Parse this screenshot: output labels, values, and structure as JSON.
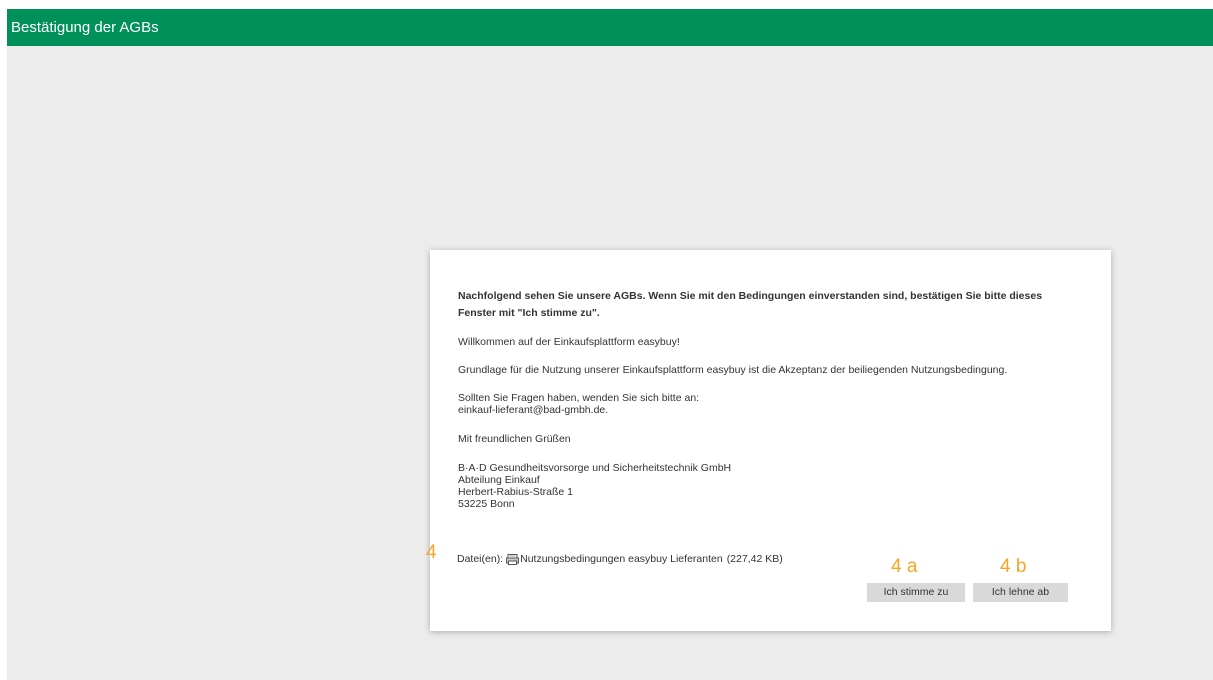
{
  "window": {
    "title": "Bestätigung der AGBs"
  },
  "dialog": {
    "intro": [
      "Nachfolgend sehen Sie unsere AGBs. Wenn Sie mit den Bedingungen einverstanden sind, bestätigen Sie bitte dieses",
      "Fenster mit \"Ich stimme zu\"."
    ],
    "welcome": "Willkommen auf der Einkaufsplattform easybuy!",
    "basis": "Grundlage für die Nutzung unserer Einkaufsplattform easybuy ist die Akzeptanz der beiliegenden Nutzungsbedingung.",
    "questions": [
      "Sollten Sie Fragen haben, wenden Sie sich bitte an:",
      "einkauf-lieferant@bad-gmbh.de."
    ],
    "greeting": "Mit freundlichen Grüßen",
    "company": [
      "B·A·D Gesundheitsvorsorge und Sicherheitstechnik GmbH",
      "Abteilung Einkauf",
      "Herbert-Rabius-Straße 1",
      "53225 Bonn"
    ],
    "files": {
      "label": "Datei(en):",
      "icon": "pdf-file-icon",
      "name": "Nutzungsbedingungen easybuy Lieferanten",
      "size": "(227,42 KB)"
    },
    "buttons": {
      "agree": "Ich stimme zu",
      "decline": "Ich lehne ab"
    }
  },
  "annotations": {
    "files": "4",
    "agree": "4 a",
    "decline": "4 b"
  },
  "colors": {
    "titlebar": "#00915b",
    "background": "#ececec",
    "button": "#d9d9d9",
    "annotation": "#f5a623"
  }
}
